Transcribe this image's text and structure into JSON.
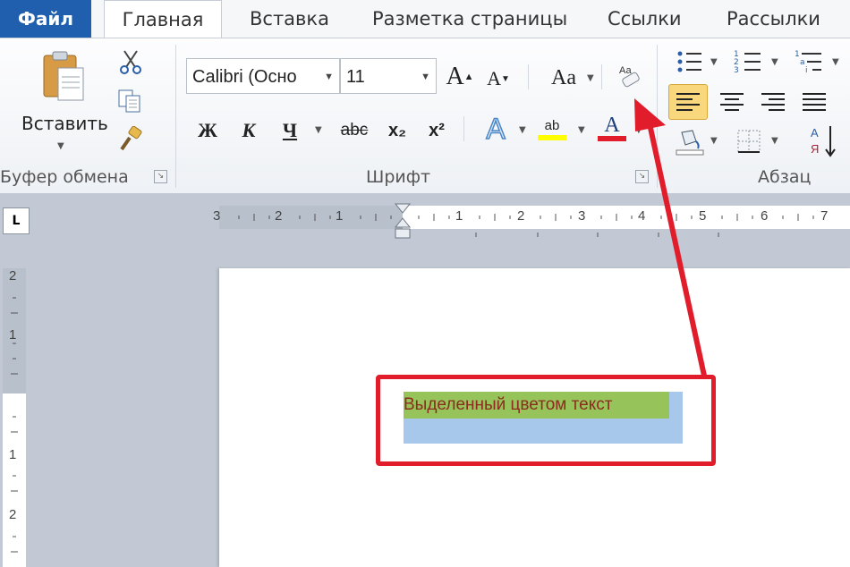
{
  "tabs": {
    "file": "Файл",
    "home": "Главная",
    "insert": "Вставка",
    "layout": "Разметка страницы",
    "references": "Ссылки",
    "mailings": "Рассылки"
  },
  "clipboard": {
    "paste_label": "Вставить",
    "group_label": "Буфер обмена"
  },
  "font": {
    "font_name": "Calibri (Осно",
    "font_size": "11",
    "grow_glyph": "A",
    "shrink_glyph": "A",
    "change_case_glyph": "Aa",
    "bold_glyph": "Ж",
    "italic_glyph": "К",
    "underline_glyph": "Ч",
    "strike_glyph": "abc",
    "subscript_glyph": "x₂",
    "superscript_glyph": "x²",
    "effects_glyph": "A",
    "highlight_glyph": "ab",
    "color_glyph": "A",
    "group_label": "Шрифт"
  },
  "paragraph": {
    "group_label": "Абзац"
  },
  "ruler": {
    "h_ticks": [
      "3",
      "2",
      "1",
      "1",
      "2",
      "3",
      "4",
      "5",
      "6",
      "7"
    ],
    "v_ticks": [
      "2",
      "1",
      "1",
      "2"
    ],
    "tab_selector": "L"
  },
  "document": {
    "highlighted_text": "Выделенный цветом текст"
  },
  "colors": {
    "file_tab": "#1f5fad",
    "highlight": "#96c35a",
    "selection": "#a7c8ea",
    "text": "#8c2c1e",
    "callout": "#e21d2b"
  },
  "icons": {
    "cut": "scissors-icon",
    "copy": "copy-icon",
    "format_painter": "format-painter-icon",
    "clear_formatting": "clear-formatting-icon",
    "bullets": "bullets-icon",
    "numbering": "numbering-icon",
    "multilevel": "multilevel-list-icon",
    "align_left": "align-left-icon",
    "align_center": "align-center-icon",
    "align_right": "align-right-icon",
    "justify": "justify-icon",
    "shading": "shading-icon",
    "borders": "borders-icon",
    "sort": "sort-icon"
  }
}
